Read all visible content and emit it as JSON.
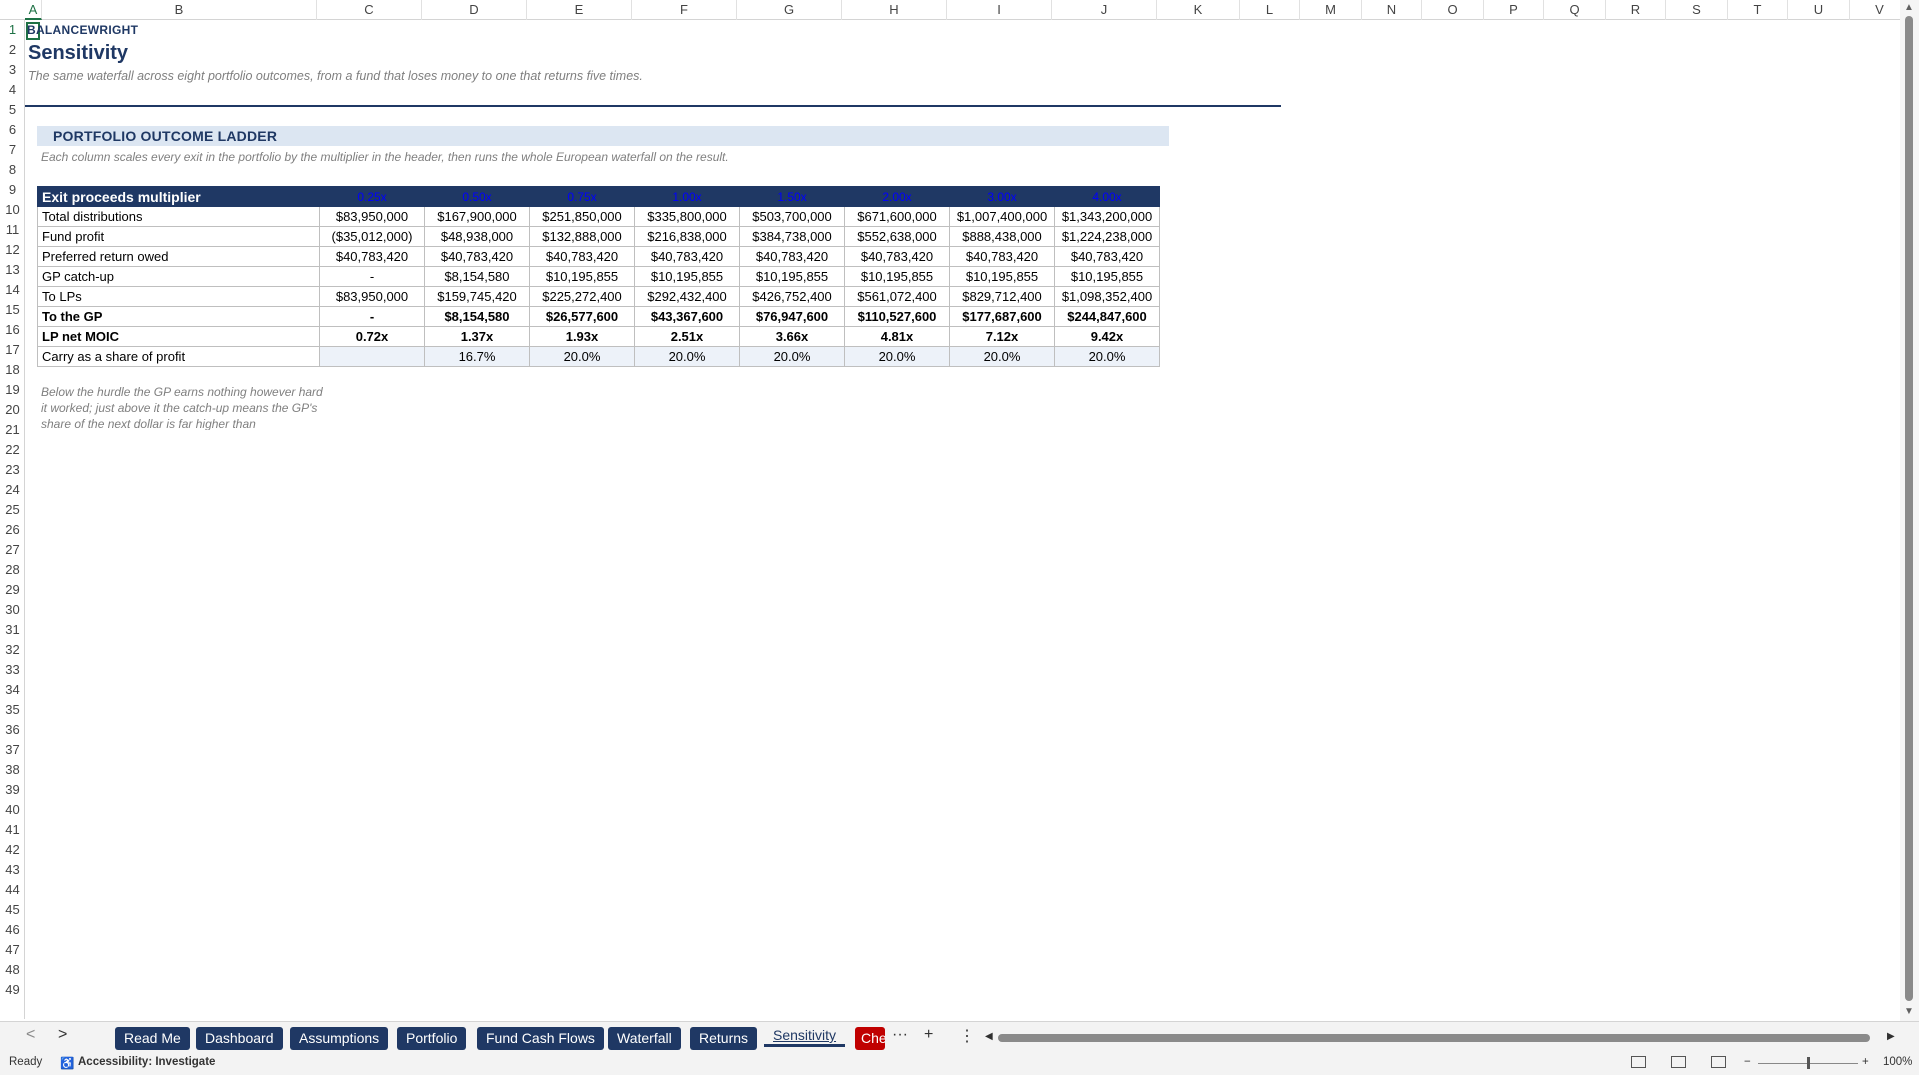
{
  "sheet": {
    "brand": "BALANCEWRIGHT",
    "title": "Sensitivity",
    "subtitle": "The same waterfall across eight portfolio outcomes, from a fund that loses money to one that returns five times.",
    "section_title": "PORTFOLIO OUTCOME LADDER",
    "section_note": "Each column scales every exit in the portfolio by the multiplier in the header, then runs the whole European waterfall on the result.",
    "footnote": "Below the hurdle the GP earns nothing however hard it worked; just above it the catch-up means the GP's share of the next dollar is far higher than"
  },
  "columns": [
    "A",
    "B",
    "C",
    "D",
    "E",
    "F",
    "G",
    "H",
    "I",
    "J",
    "K",
    "L",
    "M",
    "N",
    "O",
    "P",
    "Q",
    "R",
    "S",
    "T",
    "U",
    "V"
  ],
  "rows": [
    "1",
    "2",
    "3",
    "4",
    "5",
    "6",
    "7",
    "8",
    "9",
    "10",
    "11",
    "12",
    "13",
    "14",
    "15",
    "16",
    "17",
    "18",
    "19",
    "20",
    "21",
    "22",
    "23",
    "24",
    "25",
    "26",
    "27",
    "28",
    "29",
    "30",
    "31",
    "32",
    "33",
    "34",
    "35",
    "36",
    "37",
    "38",
    "39",
    "40",
    "41",
    "42",
    "43",
    "44",
    "45",
    "46",
    "47",
    "48",
    "49"
  ],
  "table": {
    "header_label": "Exit proceeds multiplier",
    "multipliers": [
      "0.25x",
      "0.50x",
      "0.75x",
      "1.00x",
      "1.50x",
      "2.00x",
      "3.00x",
      "4.00x"
    ],
    "rows": [
      {
        "label": "Total distributions",
        "values": [
          "$83,950,000",
          "$167,900,000",
          "$251,850,000",
          "$335,800,000",
          "$503,700,000",
          "$671,600,000",
          "$1,007,400,000",
          "$1,343,200,000"
        ]
      },
      {
        "label": "Fund profit",
        "values": [
          "($35,012,000)",
          "$48,938,000",
          "$132,888,000",
          "$216,838,000",
          "$384,738,000",
          "$552,638,000",
          "$888,438,000",
          "$1,224,238,000"
        ]
      },
      {
        "label": "Preferred return owed",
        "values": [
          "$40,783,420",
          "$40,783,420",
          "$40,783,420",
          "$40,783,420",
          "$40,783,420",
          "$40,783,420",
          "$40,783,420",
          "$40,783,420"
        ]
      },
      {
        "label": "GP catch-up",
        "values": [
          "-",
          "$8,154,580",
          "$10,195,855",
          "$10,195,855",
          "$10,195,855",
          "$10,195,855",
          "$10,195,855",
          "$10,195,855"
        ]
      },
      {
        "label": "To LPs",
        "values": [
          "$83,950,000",
          "$159,745,420",
          "$225,272,400",
          "$292,432,400",
          "$426,752,400",
          "$561,072,400",
          "$829,712,400",
          "$1,098,352,400"
        ]
      },
      {
        "label": "To the GP",
        "values": [
          "-",
          "$8,154,580",
          "$26,577,600",
          "$43,367,600",
          "$76,947,600",
          "$110,527,600",
          "$177,687,600",
          "$244,847,600"
        ]
      },
      {
        "label": "LP net MOIC",
        "values": [
          "0.72x",
          "1.37x",
          "1.93x",
          "2.51x",
          "3.66x",
          "4.81x",
          "7.12x",
          "9.42x"
        ]
      },
      {
        "label": "Carry as a share of profit",
        "values": [
          "",
          "16.7%",
          "20.0%",
          "20.0%",
          "20.0%",
          "20.0%",
          "20.0%",
          "20.0%"
        ]
      }
    ]
  },
  "tabs": [
    {
      "label": "Read Me"
    },
    {
      "label": "Dashboard"
    },
    {
      "label": "Assumptions"
    },
    {
      "label": "Portfolio"
    },
    {
      "label": "Fund Cash Flows"
    },
    {
      "label": "Waterfall"
    },
    {
      "label": "Returns"
    },
    {
      "label": "Sensitivity"
    },
    {
      "label": "Checks"
    }
  ],
  "tab_controls": {
    "more": "···",
    "add": "+",
    "options": "⋮",
    "prev": "<",
    "next": ">"
  },
  "status": {
    "ready": "Ready",
    "accessibility": "Accessibility: Investigate",
    "zoom_minus": "−",
    "zoom_plus": "+",
    "zoom_level": "100%"
  },
  "colors": {
    "navy": "#1f3864",
    "light_band": "#dce6f2",
    "red_tab": "#c00000",
    "multiplier_text": "#0000ff"
  }
}
